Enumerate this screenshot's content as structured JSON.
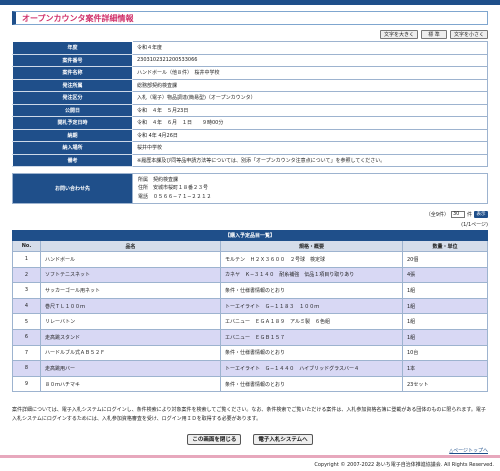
{
  "page_title": "オープンカウンタ案件詳細情報",
  "font_buttons": {
    "larger": "文字を大きく",
    "standard": "標 準",
    "smaller": "文字を小さく"
  },
  "info_rows": [
    {
      "label": "年度",
      "value": "令和４年度"
    },
    {
      "label": "案件番号",
      "value": "2303102321200533066"
    },
    {
      "label": "案件名称",
      "value": "ハンドボール（他８件）　桜井中学校"
    },
    {
      "label": "発注所属",
      "value": "総務部契約検査課"
    },
    {
      "label": "発注区分",
      "value": "入札（電子）物品調達(簡易型)（オープンカウンタ）"
    },
    {
      "label": "公開日",
      "value": "令和　４年　５月23日"
    },
    {
      "label": "開札予定日時",
      "value": "令和　４年　６月　１日　　９時00分"
    },
    {
      "label": "納期",
      "value": "令和 4年 4月26日"
    },
    {
      "label": "納入場所",
      "value": "桜井中学校"
    },
    {
      "label": "備考",
      "value": "※履歴本課及び同等品申請方法等については、別添「オープンカウンタ注意点について」を参照してください。"
    }
  ],
  "contact": {
    "label": "お問い合わせ先",
    "line1": "所属　契約検査課",
    "line2": "住所　安城市桜町１８番２３号",
    "line3": "電話　０５６６−７１−２２１２"
  },
  "pagination": {
    "total_label": "（全9件）",
    "per_page": "30",
    "per_page_suffix": "件",
    "go": "表示",
    "page": "(1/1ページ)"
  },
  "goods": {
    "caption": "【購入予定品目一覧】",
    "headers": {
      "no": "No.",
      "name": "品名",
      "spec": "規格・概要",
      "qty": "数量・単位"
    },
    "rows": [
      {
        "no": "1",
        "name": "ハンドボール",
        "spec": "モルテン　Ｈ２Ｘ３６００　２号球　検定球",
        "qty": "20個"
      },
      {
        "no": "2",
        "name": "ソフトテニスネット",
        "spec": "カネヤ　Ｋ−３１４０　耐糸補強　伝品１項目り取りあり",
        "qty": "4張"
      },
      {
        "no": "3",
        "name": "サッカーゴール用ネット",
        "spec": "条件・仕様書情報のとおり",
        "qty": "1組"
      },
      {
        "no": "4",
        "name": "巻尺ＴＬ１００ｍ",
        "spec": "トーエイライト　Ｇ−１１８３　１００ｍ",
        "qty": "1組"
      },
      {
        "no": "5",
        "name": "リレーバトン",
        "spec": "エバニュー　ＥＧＡ１８９　アルミ製　６色組",
        "qty": "1組"
      },
      {
        "no": "6",
        "name": "走高跳スタンド",
        "spec": "エバニュー　ＥＧＢ１５７",
        "qty": "1組"
      },
      {
        "no": "7",
        "name": "ハードルブル式ＡＢ５２Ｆ",
        "spec": "条件・仕様書情報のとおり",
        "qty": "10台"
      },
      {
        "no": "8",
        "name": "走高跳用バー",
        "spec": "トーエイライト　Ｇ−１４４０　ハイブリッドグラスバー４",
        "qty": "1本"
      },
      {
        "no": "9",
        "name": "８０ｍハチマキ",
        "spec": "条件・仕様書情報のとおり",
        "qty": "23セット"
      }
    ]
  },
  "note": "案件詳細については、電子入札システムにログインし、条件検索により対象案件を検索してご覧ください。なお、条件検索でご覧いただける案件は、入札参加資格名簿に登載がある団体のものに限られます。電子入札システムにログインするためには、入札参加資格審査を受け、ログイン用ＩＤを取得する必要があります。",
  "buttons": {
    "close": "この画面を閉じる",
    "to_system": "電子入札システムへ"
  },
  "pagetop": "△ページトップへ",
  "copyright": "Copyright © 2007-2022 あいち電子自治体推進協議会. All Rights Reserved."
}
